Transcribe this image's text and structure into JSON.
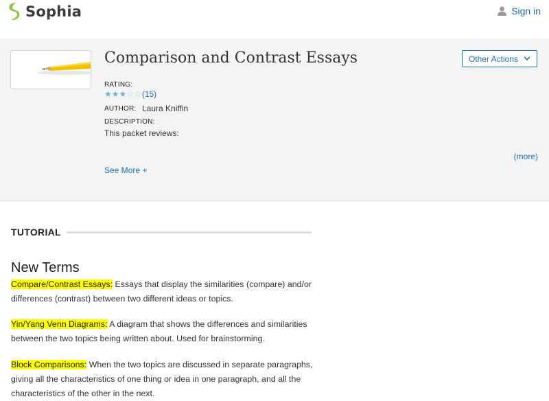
{
  "header": {
    "logo_text": "Sophia",
    "signin_label": "Sign in"
  },
  "resource": {
    "title": "Comparison and Contrast Essays",
    "other_actions_label": "Other Actions",
    "rating_label": "RATING:",
    "rating_stars": 3,
    "rating_max": 5,
    "rating_count": "(15)",
    "author_label": "AUTHOR:",
    "author_name": "Laura Kniffin",
    "description_label": "DESCRIPTION:",
    "description_text": "This packet reviews:",
    "more_link": "(more)",
    "see_more": "See More +"
  },
  "tutorial": {
    "section_label": "TUTORIAL",
    "heading": "New Terms",
    "terms": [
      {
        "term": "Compare/Contrast Essays:",
        "definition": " Essays that display the similarities (compare) and/or differences (contrast) between two different ideas or topics."
      },
      {
        "term": "Yin/Yang Venn Diagrams:",
        "definition": " A diagram that shows the differences and similarities between the two topics being written about. Used for brainstorming."
      },
      {
        "term": "Block Comparisons:",
        "definition": " When the two topics are discussed in separate paragraphs, giving all the characteristics of one thing or idea in one paragraph, and all the characteristics of the other in the next."
      }
    ]
  },
  "colors": {
    "link": "#1f6fa8",
    "highlight": "#ffff00",
    "logo_green": "#8dc63f",
    "banner_bg": "#f4f4f4"
  }
}
